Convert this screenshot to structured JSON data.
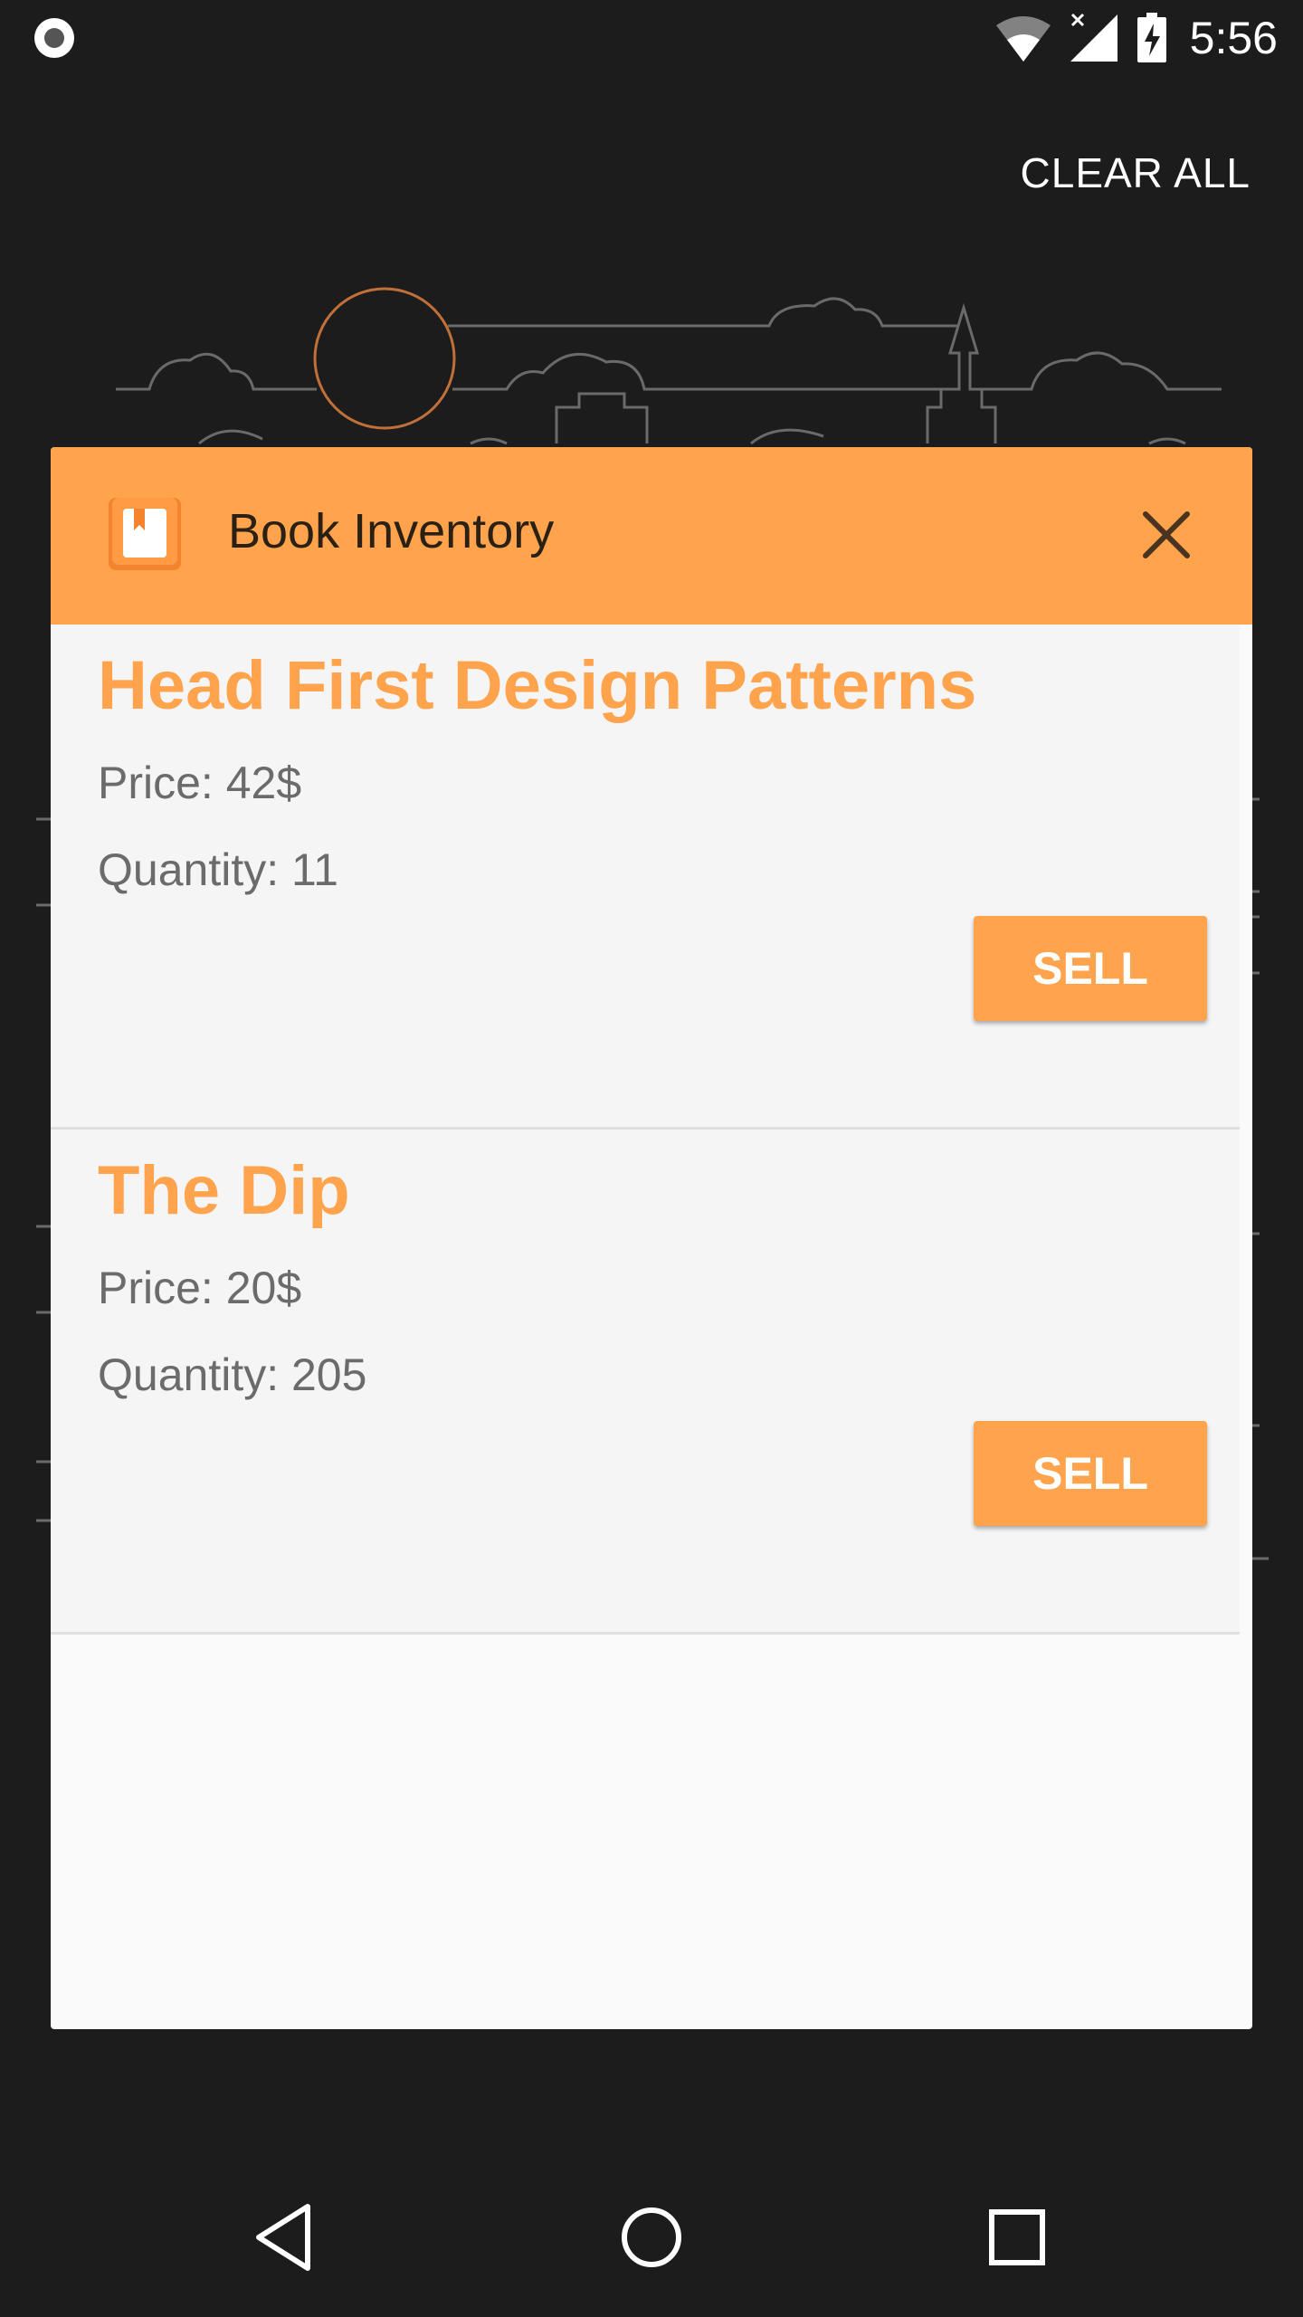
{
  "status_bar": {
    "time": "5:56",
    "icons": [
      "record-icon",
      "wifi-icon",
      "cellular-signal-icon",
      "battery-charging-icon"
    ]
  },
  "toolbar": {
    "clear_all_label": "CLEAR ALL"
  },
  "task_card": {
    "app_title": "Book Inventory",
    "app_icon": "book-icon",
    "close_icon": "close-icon",
    "header_color": "#ffa34d"
  },
  "books": [
    {
      "title": "Head First Design Patterns",
      "price": "Price: 42$",
      "quantity": "Quantity: 11",
      "sell_label": "SELL"
    },
    {
      "title": "The Dip",
      "price": "Price: 20$",
      "quantity": "Quantity: 205",
      "sell_label": "SELL"
    }
  ],
  "nav_bar": {
    "icons": [
      "back-icon",
      "home-icon",
      "recents-icon"
    ]
  },
  "colors": {
    "accent": "#ffa34d",
    "background": "#1c1c1c",
    "card": "#fafafa",
    "item": "#f5f5f5",
    "secondary_text": "#6b6b6b"
  }
}
